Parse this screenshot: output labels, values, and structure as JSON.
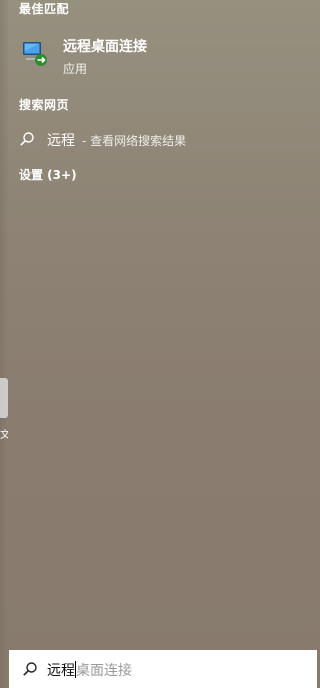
{
  "best_match": {
    "header": "最佳匹配",
    "app_name": "远程桌面连接",
    "app_type": "应用",
    "icon": "remote-desktop-icon"
  },
  "web_search": {
    "header": "搜索网页",
    "query": "远程",
    "hint": "- 查看网络搜索结果",
    "icon": "search-icon"
  },
  "settings": {
    "header": "设置 (3+)"
  },
  "search_box": {
    "typed": "远程",
    "suggestion": "桌面连接",
    "icon": "search-icon"
  },
  "desktop_peek": {
    "label": "文"
  },
  "colors": {
    "panel_bg": "#8d8273",
    "text": "#ffffff",
    "search_bg": "#ffffff",
    "suggestion_text": "#9a9a9a"
  }
}
